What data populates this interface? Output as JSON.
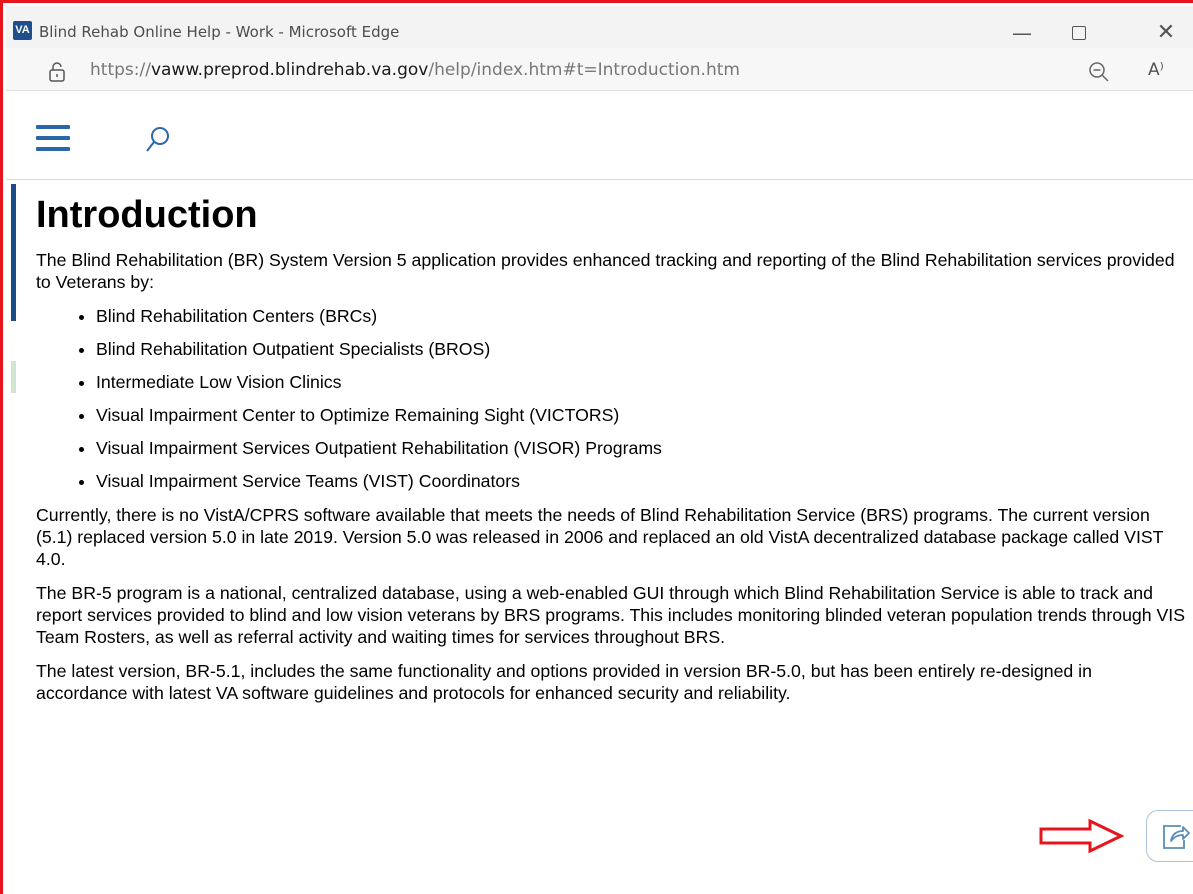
{
  "window": {
    "app_icon_text": "VA",
    "title": "Blind Rehab Online Help - Work - Microsoft Edge",
    "min_glyph": "—",
    "close_glyph": "✕"
  },
  "address": {
    "url_scheme": "https://",
    "url_host": "vaww.preprod.blindrehab.va.gov",
    "url_path": "/help/index.htm#t=Introduction.htm",
    "read_aloud_label": "A⁾"
  },
  "icons": {
    "lock": "lock-icon",
    "zoom_out": "zoom-out-icon",
    "menu": "hamburger-menu-icon",
    "search": "search-icon",
    "share": "share-icon"
  },
  "colors": {
    "frame_border": "#e8141c",
    "menu_blue": "#2a67a8",
    "arrow_red": "#e8141c"
  },
  "page": {
    "title": "Introduction",
    "intro": "The Blind Rehabilitation (BR) System Version 5 application provides enhanced tracking and reporting of the Blind Rehabilitation services provided to Veterans by:",
    "list": [
      "Blind Rehabilitation Centers (BRCs)",
      "Blind Rehabilitation Outpatient Specialists (BROS)",
      "Intermediate Low Vision Clinics",
      "Visual Impairment Center to Optimize Remaining Sight (VICTORS)",
      "Visual Impairment Services Outpatient Rehabilitation (VISOR) Programs",
      "Visual Impairment Service Teams (VIST) Coordinators"
    ],
    "para1": "Currently, there is no VistA/CPRS software available that meets the needs of Blind Rehabilitation Service (BRS) programs.  The current version (5.1) replaced version 5.0 in late 2019. Version 5.0 was released in 2006 and replaced an old VistA decentralized database package called VIST 4.0.",
    "para2": "The BR-5 program is a national, centralized database, using a web-enabled GUI through which Blind Rehabilitation Service is able to track and report services provided to blind and low vision veterans by BRS programs. This includes monitoring blinded veteran population trends through VIS Team Rosters, as well as referral activity and waiting times for services throughout BRS.",
    "para3": "The latest version, BR-5.1, includes the same functionality and options provided in version BR-5.0, but has been entirely re-designed in accordance with latest VA software guidelines and protocols for enhanced security and reliability."
  }
}
